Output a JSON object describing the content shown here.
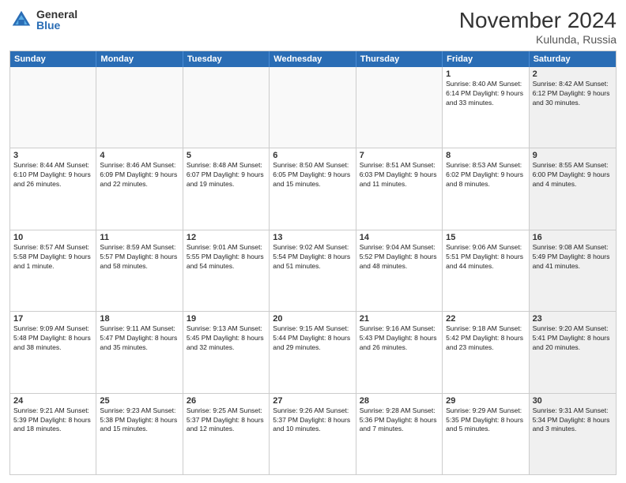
{
  "header": {
    "logo_general": "General",
    "logo_blue": "Blue",
    "month_title": "November 2024",
    "location": "Kulunda, Russia"
  },
  "day_headers": [
    "Sunday",
    "Monday",
    "Tuesday",
    "Wednesday",
    "Thursday",
    "Friday",
    "Saturday"
  ],
  "weeks": [
    [
      {
        "num": "",
        "info": "",
        "empty": true
      },
      {
        "num": "",
        "info": "",
        "empty": true
      },
      {
        "num": "",
        "info": "",
        "empty": true
      },
      {
        "num": "",
        "info": "",
        "empty": true
      },
      {
        "num": "",
        "info": "",
        "empty": true
      },
      {
        "num": "1",
        "info": "Sunrise: 8:40 AM\nSunset: 6:14 PM\nDaylight: 9 hours and 33 minutes.",
        "empty": false,
        "shaded": false
      },
      {
        "num": "2",
        "info": "Sunrise: 8:42 AM\nSunset: 6:12 PM\nDaylight: 9 hours and 30 minutes.",
        "empty": false,
        "shaded": true
      }
    ],
    [
      {
        "num": "3",
        "info": "Sunrise: 8:44 AM\nSunset: 6:10 PM\nDaylight: 9 hours and 26 minutes.",
        "empty": false,
        "shaded": false
      },
      {
        "num": "4",
        "info": "Sunrise: 8:46 AM\nSunset: 6:09 PM\nDaylight: 9 hours and 22 minutes.",
        "empty": false,
        "shaded": false
      },
      {
        "num": "5",
        "info": "Sunrise: 8:48 AM\nSunset: 6:07 PM\nDaylight: 9 hours and 19 minutes.",
        "empty": false,
        "shaded": false
      },
      {
        "num": "6",
        "info": "Sunrise: 8:50 AM\nSunset: 6:05 PM\nDaylight: 9 hours and 15 minutes.",
        "empty": false,
        "shaded": false
      },
      {
        "num": "7",
        "info": "Sunrise: 8:51 AM\nSunset: 6:03 PM\nDaylight: 9 hours and 11 minutes.",
        "empty": false,
        "shaded": false
      },
      {
        "num": "8",
        "info": "Sunrise: 8:53 AM\nSunset: 6:02 PM\nDaylight: 9 hours and 8 minutes.",
        "empty": false,
        "shaded": false
      },
      {
        "num": "9",
        "info": "Sunrise: 8:55 AM\nSunset: 6:00 PM\nDaylight: 9 hours and 4 minutes.",
        "empty": false,
        "shaded": true
      }
    ],
    [
      {
        "num": "10",
        "info": "Sunrise: 8:57 AM\nSunset: 5:58 PM\nDaylight: 9 hours and 1 minute.",
        "empty": false,
        "shaded": false
      },
      {
        "num": "11",
        "info": "Sunrise: 8:59 AM\nSunset: 5:57 PM\nDaylight: 8 hours and 58 minutes.",
        "empty": false,
        "shaded": false
      },
      {
        "num": "12",
        "info": "Sunrise: 9:01 AM\nSunset: 5:55 PM\nDaylight: 8 hours and 54 minutes.",
        "empty": false,
        "shaded": false
      },
      {
        "num": "13",
        "info": "Sunrise: 9:02 AM\nSunset: 5:54 PM\nDaylight: 8 hours and 51 minutes.",
        "empty": false,
        "shaded": false
      },
      {
        "num": "14",
        "info": "Sunrise: 9:04 AM\nSunset: 5:52 PM\nDaylight: 8 hours and 48 minutes.",
        "empty": false,
        "shaded": false
      },
      {
        "num": "15",
        "info": "Sunrise: 9:06 AM\nSunset: 5:51 PM\nDaylight: 8 hours and 44 minutes.",
        "empty": false,
        "shaded": false
      },
      {
        "num": "16",
        "info": "Sunrise: 9:08 AM\nSunset: 5:49 PM\nDaylight: 8 hours and 41 minutes.",
        "empty": false,
        "shaded": true
      }
    ],
    [
      {
        "num": "17",
        "info": "Sunrise: 9:09 AM\nSunset: 5:48 PM\nDaylight: 8 hours and 38 minutes.",
        "empty": false,
        "shaded": false
      },
      {
        "num": "18",
        "info": "Sunrise: 9:11 AM\nSunset: 5:47 PM\nDaylight: 8 hours and 35 minutes.",
        "empty": false,
        "shaded": false
      },
      {
        "num": "19",
        "info": "Sunrise: 9:13 AM\nSunset: 5:45 PM\nDaylight: 8 hours and 32 minutes.",
        "empty": false,
        "shaded": false
      },
      {
        "num": "20",
        "info": "Sunrise: 9:15 AM\nSunset: 5:44 PM\nDaylight: 8 hours and 29 minutes.",
        "empty": false,
        "shaded": false
      },
      {
        "num": "21",
        "info": "Sunrise: 9:16 AM\nSunset: 5:43 PM\nDaylight: 8 hours and 26 minutes.",
        "empty": false,
        "shaded": false
      },
      {
        "num": "22",
        "info": "Sunrise: 9:18 AM\nSunset: 5:42 PM\nDaylight: 8 hours and 23 minutes.",
        "empty": false,
        "shaded": false
      },
      {
        "num": "23",
        "info": "Sunrise: 9:20 AM\nSunset: 5:41 PM\nDaylight: 8 hours and 20 minutes.",
        "empty": false,
        "shaded": true
      }
    ],
    [
      {
        "num": "24",
        "info": "Sunrise: 9:21 AM\nSunset: 5:39 PM\nDaylight: 8 hours and 18 minutes.",
        "empty": false,
        "shaded": false
      },
      {
        "num": "25",
        "info": "Sunrise: 9:23 AM\nSunset: 5:38 PM\nDaylight: 8 hours and 15 minutes.",
        "empty": false,
        "shaded": false
      },
      {
        "num": "26",
        "info": "Sunrise: 9:25 AM\nSunset: 5:37 PM\nDaylight: 8 hours and 12 minutes.",
        "empty": false,
        "shaded": false
      },
      {
        "num": "27",
        "info": "Sunrise: 9:26 AM\nSunset: 5:37 PM\nDaylight: 8 hours and 10 minutes.",
        "empty": false,
        "shaded": false
      },
      {
        "num": "28",
        "info": "Sunrise: 9:28 AM\nSunset: 5:36 PM\nDaylight: 8 hours and 7 minutes.",
        "empty": false,
        "shaded": false
      },
      {
        "num": "29",
        "info": "Sunrise: 9:29 AM\nSunset: 5:35 PM\nDaylight: 8 hours and 5 minutes.",
        "empty": false,
        "shaded": false
      },
      {
        "num": "30",
        "info": "Sunrise: 9:31 AM\nSunset: 5:34 PM\nDaylight: 8 hours and 3 minutes.",
        "empty": false,
        "shaded": true
      }
    ]
  ]
}
